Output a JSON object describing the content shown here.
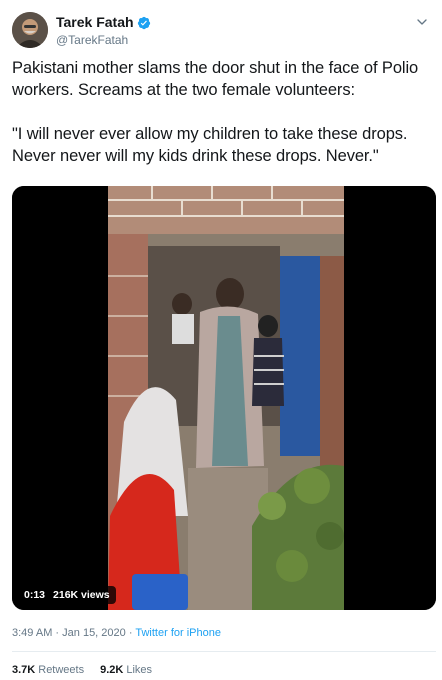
{
  "author": {
    "name": "Tarek Fatah",
    "handle": "@TarekFatah"
  },
  "tweet": {
    "paragraphs": [
      "Pakistani mother slams the door shut in the face of Polio workers. Screams at the two female volunteers:",
      "\"I will never ever allow my children to take these drops. Never never will my kids drink these drops. Never.\""
    ]
  },
  "video": {
    "duration": "0:13",
    "views": "216K views"
  },
  "meta": {
    "time": "3:49 AM",
    "separator": "·",
    "date": "Jan 15, 2020",
    "source": "Twitter for iPhone"
  },
  "stats": {
    "retweets_count": "3.7K",
    "retweets_label": "Retweets",
    "likes_count": "9.2K",
    "likes_label": "Likes"
  },
  "colors": {
    "link": "#1da1f2",
    "secondary_text": "#657786",
    "primary_text": "#14171a",
    "divider": "#e6ecf0"
  }
}
